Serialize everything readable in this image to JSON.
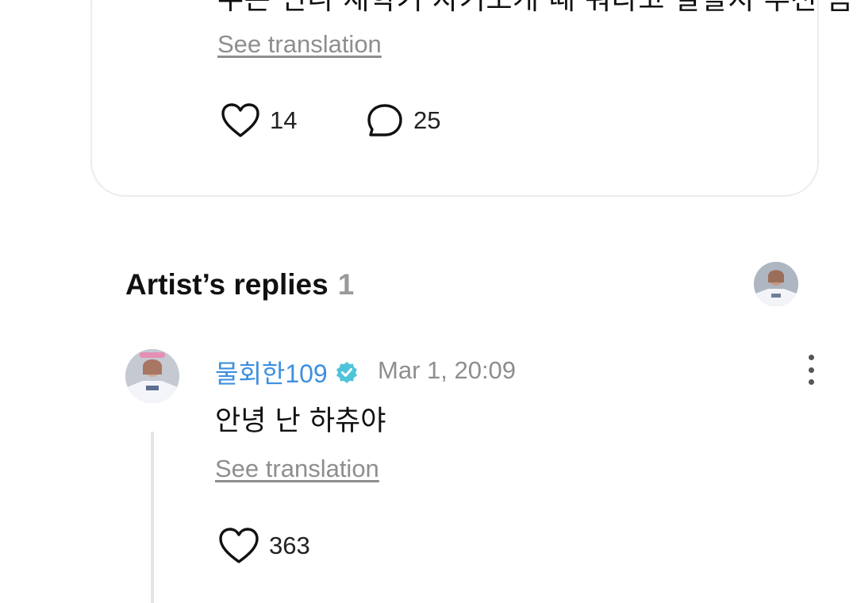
{
  "post": {
    "text": "주은 언니 새학기 자기소개 때 뭐라고 말할지 추천 좀",
    "see_translation": "See translation",
    "likes": "14",
    "comments": "25",
    "like_icon": "heart-outline-icon",
    "comment_icon": "speech-bubble-icon"
  },
  "replies_section": {
    "title": "Artist’s replies",
    "count": "1"
  },
  "reply": {
    "author": "물회한109",
    "verified_icon": "verified-badge-icon",
    "date": "Mar 1, 20:09",
    "text": "안녕 난 하츄야",
    "see_translation": "See translation",
    "likes": "363"
  },
  "colors": {
    "author_name": "#3d8fe0",
    "verified_badge": "#4fc3d9",
    "muted_text": "#8e8e8e",
    "card_border": "#ececec"
  }
}
